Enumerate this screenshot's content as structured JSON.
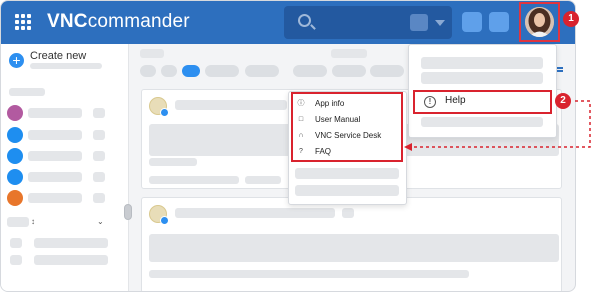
{
  "topbar": {
    "brand_bold": "VNC",
    "brand_rest": "commander",
    "search_icon": "search-icon",
    "menu_icon": "apps-grid-icon"
  },
  "sidebar": {
    "create_label": "Create new",
    "create_icon": "plus-icon",
    "item_colors": [
      "#b25aa0",
      "#1e8ef0",
      "#1e8ef0",
      "#1e8ef0",
      "#e8762b"
    ]
  },
  "menu": {
    "items": [
      {
        "label": "App info",
        "icon": "info-icon"
      },
      {
        "label": "User Manual",
        "icon": "document-icon"
      },
      {
        "label": "VNC Service Desk",
        "icon": "headset-icon"
      },
      {
        "label": "FAQ",
        "icon": "question-icon"
      }
    ]
  },
  "panel": {
    "help_label": "Help",
    "help_icon": "alert-circle-icon"
  },
  "callouts": {
    "one": "1",
    "two": "2"
  },
  "colors": {
    "topbar": "#2d6fbe",
    "accent": "#2d8ff0",
    "highlight": "#d9232e"
  }
}
